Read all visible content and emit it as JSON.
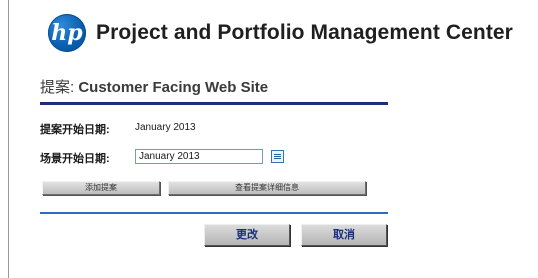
{
  "app": {
    "logo_text": "hp",
    "title": "Project and Portfolio Management Center"
  },
  "proposal": {
    "title_prefix": "提案:",
    "title_name": "Customer Facing Web Site"
  },
  "fields": {
    "proposal_start_label": "提案开始日期:",
    "proposal_start_value": "January 2013",
    "scenario_start_label": "场景开始日期:",
    "scenario_start_value": "January 2013"
  },
  "actions": {
    "add_proposal": "添加提案",
    "view_details": "查看提案详细信息",
    "change": "更改",
    "cancel": "取消"
  },
  "icons": {
    "calendar": "calendar-icon"
  },
  "colors": {
    "title_rule": "#1a2f7a",
    "bottom_rule": "#2b6cc4",
    "button_text": "#1a2f7a",
    "logo_blue": "#0a5fb0"
  }
}
